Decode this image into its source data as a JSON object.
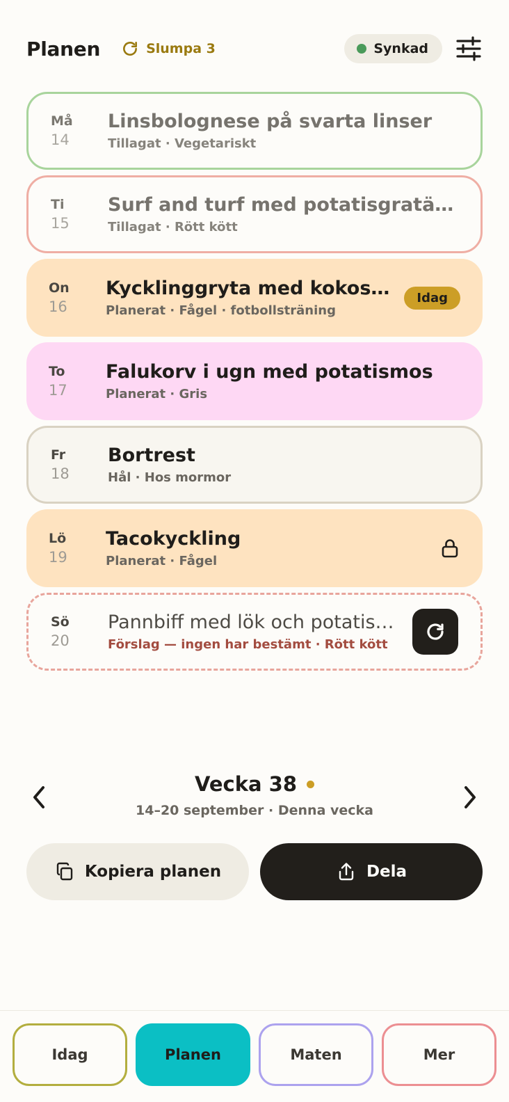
{
  "header": {
    "title": "Planen",
    "shuffle_label": "Slumpa 3",
    "sync_label": "Synkad"
  },
  "days": [
    {
      "day": "Må",
      "date": "14",
      "meal": "Linsbolognese på svarta linser",
      "details": "Tillagat · Vegetariskt",
      "style": "done-green"
    },
    {
      "day": "Ti",
      "date": "15",
      "meal": "Surf and turf med potatisgratäng",
      "details": "Tillagat · Rött kött",
      "style": "done-red"
    },
    {
      "day": "On",
      "date": "16",
      "meal": "Kycklinggryta med kokos och lime",
      "details": "Planerat · Fågel · fotbollsträning",
      "style": "orange",
      "badge": "Idag"
    },
    {
      "day": "To",
      "date": "17",
      "meal": "Falukorv i ugn med potatismos",
      "details": "Planerat · Gris",
      "style": "pink"
    },
    {
      "day": "Fr",
      "date": "18",
      "meal": "Bortrest",
      "details": "Hål · Hos mormor",
      "style": "beige"
    },
    {
      "day": "Lö",
      "date": "19",
      "meal": "Tacokyckling",
      "details": "Planerat · Fågel",
      "style": "orange",
      "locked": true
    },
    {
      "day": "Sö",
      "date": "20",
      "meal": "Pannbiff med lök och potatismos",
      "details": "Förslag — ingen har bestämt · Rött kött",
      "style": "suggestion"
    }
  ],
  "week": {
    "title": "Vecka 38",
    "range": "14–20 september · Denna vecka"
  },
  "actions": {
    "copy_label": "Kopiera planen",
    "share_label": "Dela"
  },
  "tabs": [
    {
      "label": "Idag"
    },
    {
      "label": "Planen",
      "active": true
    },
    {
      "label": "Maten"
    },
    {
      "label": "Mer"
    }
  ],
  "icons": {
    "shuffle": "refresh-icon",
    "filter": "sliders-icon",
    "lock": "lock-icon",
    "reroll": "refresh-icon",
    "prev": "chevron-left-icon",
    "next": "chevron-right-icon",
    "copy": "copy-icon",
    "share": "share-icon"
  },
  "colors": {
    "accent_gold": "#cc9e26",
    "sync_dot": "#4a9a5a",
    "tab_active": "#0bbfc4",
    "dark": "#221f1b"
  }
}
